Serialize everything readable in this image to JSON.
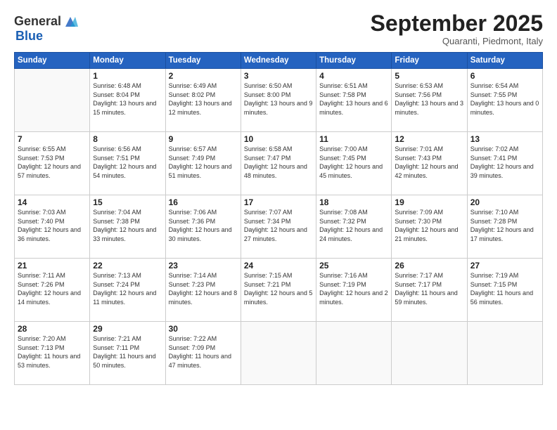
{
  "logo": {
    "general": "General",
    "blue": "Blue"
  },
  "title": "September 2025",
  "subtitle": "Quaranti, Piedmont, Italy",
  "header_days": [
    "Sunday",
    "Monday",
    "Tuesday",
    "Wednesday",
    "Thursday",
    "Friday",
    "Saturday"
  ],
  "weeks": [
    [
      {
        "day": "",
        "sunrise": "",
        "sunset": "",
        "daylight": ""
      },
      {
        "day": "1",
        "sunrise": "Sunrise: 6:48 AM",
        "sunset": "Sunset: 8:04 PM",
        "daylight": "Daylight: 13 hours and 15 minutes."
      },
      {
        "day": "2",
        "sunrise": "Sunrise: 6:49 AM",
        "sunset": "Sunset: 8:02 PM",
        "daylight": "Daylight: 13 hours and 12 minutes."
      },
      {
        "day": "3",
        "sunrise": "Sunrise: 6:50 AM",
        "sunset": "Sunset: 8:00 PM",
        "daylight": "Daylight: 13 hours and 9 minutes."
      },
      {
        "day": "4",
        "sunrise": "Sunrise: 6:51 AM",
        "sunset": "Sunset: 7:58 PM",
        "daylight": "Daylight: 13 hours and 6 minutes."
      },
      {
        "day": "5",
        "sunrise": "Sunrise: 6:53 AM",
        "sunset": "Sunset: 7:56 PM",
        "daylight": "Daylight: 13 hours and 3 minutes."
      },
      {
        "day": "6",
        "sunrise": "Sunrise: 6:54 AM",
        "sunset": "Sunset: 7:55 PM",
        "daylight": "Daylight: 13 hours and 0 minutes."
      }
    ],
    [
      {
        "day": "7",
        "sunrise": "Sunrise: 6:55 AM",
        "sunset": "Sunset: 7:53 PM",
        "daylight": "Daylight: 12 hours and 57 minutes."
      },
      {
        "day": "8",
        "sunrise": "Sunrise: 6:56 AM",
        "sunset": "Sunset: 7:51 PM",
        "daylight": "Daylight: 12 hours and 54 minutes."
      },
      {
        "day": "9",
        "sunrise": "Sunrise: 6:57 AM",
        "sunset": "Sunset: 7:49 PM",
        "daylight": "Daylight: 12 hours and 51 minutes."
      },
      {
        "day": "10",
        "sunrise": "Sunrise: 6:58 AM",
        "sunset": "Sunset: 7:47 PM",
        "daylight": "Daylight: 12 hours and 48 minutes."
      },
      {
        "day": "11",
        "sunrise": "Sunrise: 7:00 AM",
        "sunset": "Sunset: 7:45 PM",
        "daylight": "Daylight: 12 hours and 45 minutes."
      },
      {
        "day": "12",
        "sunrise": "Sunrise: 7:01 AM",
        "sunset": "Sunset: 7:43 PM",
        "daylight": "Daylight: 12 hours and 42 minutes."
      },
      {
        "day": "13",
        "sunrise": "Sunrise: 7:02 AM",
        "sunset": "Sunset: 7:41 PM",
        "daylight": "Daylight: 12 hours and 39 minutes."
      }
    ],
    [
      {
        "day": "14",
        "sunrise": "Sunrise: 7:03 AM",
        "sunset": "Sunset: 7:40 PM",
        "daylight": "Daylight: 12 hours and 36 minutes."
      },
      {
        "day": "15",
        "sunrise": "Sunrise: 7:04 AM",
        "sunset": "Sunset: 7:38 PM",
        "daylight": "Daylight: 12 hours and 33 minutes."
      },
      {
        "day": "16",
        "sunrise": "Sunrise: 7:06 AM",
        "sunset": "Sunset: 7:36 PM",
        "daylight": "Daylight: 12 hours and 30 minutes."
      },
      {
        "day": "17",
        "sunrise": "Sunrise: 7:07 AM",
        "sunset": "Sunset: 7:34 PM",
        "daylight": "Daylight: 12 hours and 27 minutes."
      },
      {
        "day": "18",
        "sunrise": "Sunrise: 7:08 AM",
        "sunset": "Sunset: 7:32 PM",
        "daylight": "Daylight: 12 hours and 24 minutes."
      },
      {
        "day": "19",
        "sunrise": "Sunrise: 7:09 AM",
        "sunset": "Sunset: 7:30 PM",
        "daylight": "Daylight: 12 hours and 21 minutes."
      },
      {
        "day": "20",
        "sunrise": "Sunrise: 7:10 AM",
        "sunset": "Sunset: 7:28 PM",
        "daylight": "Daylight: 12 hours and 17 minutes."
      }
    ],
    [
      {
        "day": "21",
        "sunrise": "Sunrise: 7:11 AM",
        "sunset": "Sunset: 7:26 PM",
        "daylight": "Daylight: 12 hours and 14 minutes."
      },
      {
        "day": "22",
        "sunrise": "Sunrise: 7:13 AM",
        "sunset": "Sunset: 7:24 PM",
        "daylight": "Daylight: 12 hours and 11 minutes."
      },
      {
        "day": "23",
        "sunrise": "Sunrise: 7:14 AM",
        "sunset": "Sunset: 7:23 PM",
        "daylight": "Daylight: 12 hours and 8 minutes."
      },
      {
        "day": "24",
        "sunrise": "Sunrise: 7:15 AM",
        "sunset": "Sunset: 7:21 PM",
        "daylight": "Daylight: 12 hours and 5 minutes."
      },
      {
        "day": "25",
        "sunrise": "Sunrise: 7:16 AM",
        "sunset": "Sunset: 7:19 PM",
        "daylight": "Daylight: 12 hours and 2 minutes."
      },
      {
        "day": "26",
        "sunrise": "Sunrise: 7:17 AM",
        "sunset": "Sunset: 7:17 PM",
        "daylight": "Daylight: 11 hours and 59 minutes."
      },
      {
        "day": "27",
        "sunrise": "Sunrise: 7:19 AM",
        "sunset": "Sunset: 7:15 PM",
        "daylight": "Daylight: 11 hours and 56 minutes."
      }
    ],
    [
      {
        "day": "28",
        "sunrise": "Sunrise: 7:20 AM",
        "sunset": "Sunset: 7:13 PM",
        "daylight": "Daylight: 11 hours and 53 minutes."
      },
      {
        "day": "29",
        "sunrise": "Sunrise: 7:21 AM",
        "sunset": "Sunset: 7:11 PM",
        "daylight": "Daylight: 11 hours and 50 minutes."
      },
      {
        "day": "30",
        "sunrise": "Sunrise: 7:22 AM",
        "sunset": "Sunset: 7:09 PM",
        "daylight": "Daylight: 11 hours and 47 minutes."
      },
      {
        "day": "",
        "sunrise": "",
        "sunset": "",
        "daylight": ""
      },
      {
        "day": "",
        "sunrise": "",
        "sunset": "",
        "daylight": ""
      },
      {
        "day": "",
        "sunrise": "",
        "sunset": "",
        "daylight": ""
      },
      {
        "day": "",
        "sunrise": "",
        "sunset": "",
        "daylight": ""
      }
    ]
  ]
}
